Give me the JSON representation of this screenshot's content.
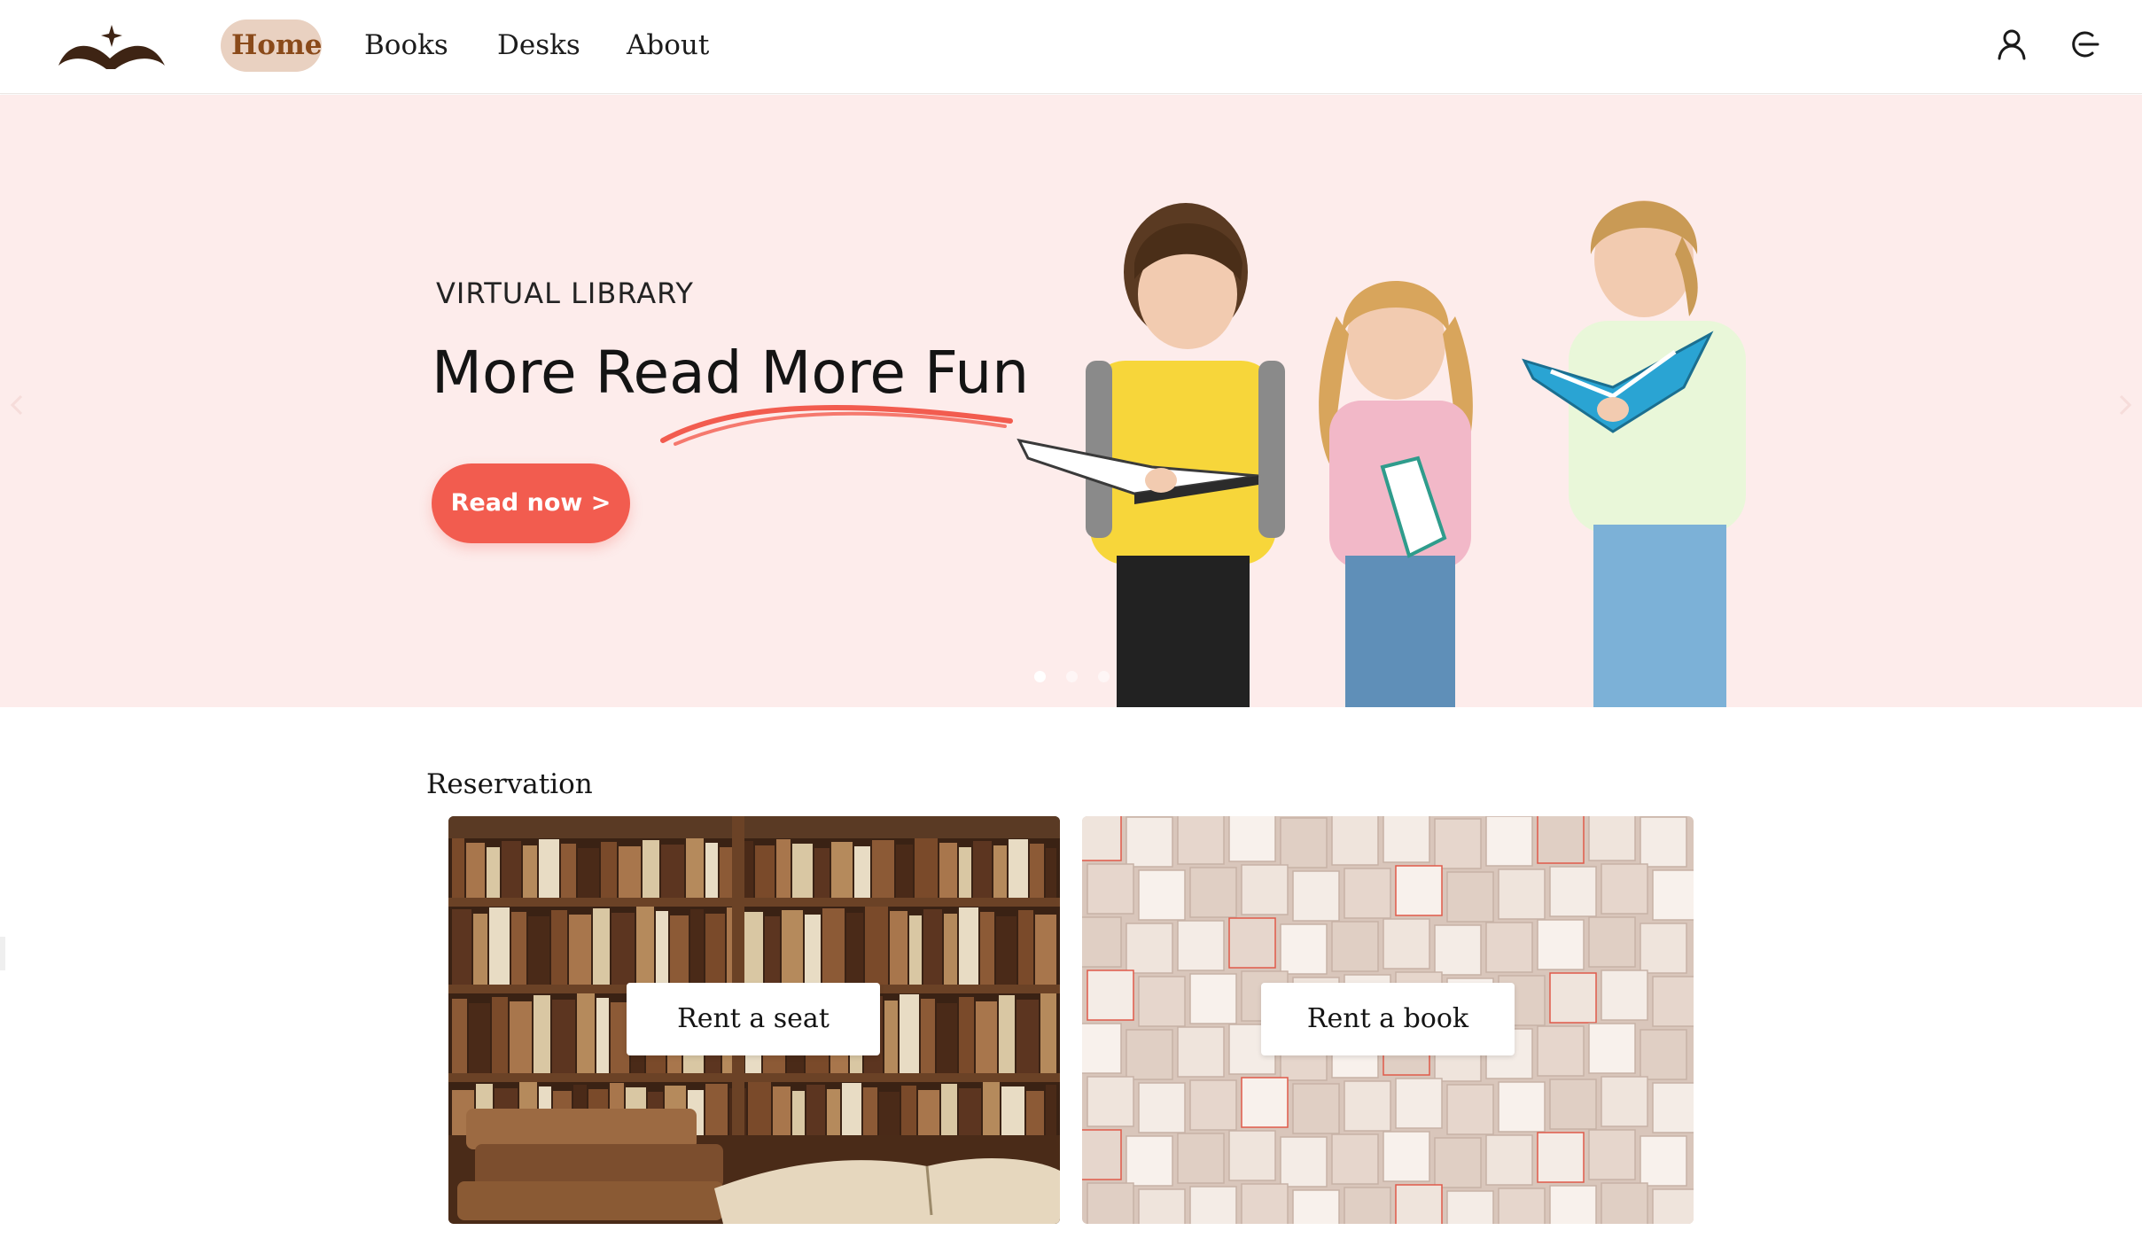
{
  "navbar": {
    "logo_icon": "open-book-star-logo",
    "links": [
      {
        "label": "Home",
        "active": true
      },
      {
        "label": "Books",
        "active": false
      },
      {
        "label": "Desks",
        "active": false
      },
      {
        "label": "About",
        "active": false
      }
    ],
    "icons": [
      "user-icon",
      "logout-icon"
    ]
  },
  "hero": {
    "eyebrow": "VIRTUAL LIBRARY",
    "title": "More Read More Fun",
    "cta_label": "Read now >",
    "illustration": "children-reading-books",
    "carousel": {
      "slides": 3,
      "active_index": 0
    },
    "colors": {
      "background": "#fdeceb",
      "accent": "#f25c4f"
    }
  },
  "reservation": {
    "title": "Reservation",
    "cards": [
      {
        "label": "Rent a seat",
        "image": "antique-library-bookshelves"
      },
      {
        "label": "Rent a book",
        "image": "open-book-pages-collage"
      }
    ]
  },
  "colors": {
    "nav_active_bg": "#e9d1c1",
    "nav_active_text": "#8a4a1a"
  }
}
